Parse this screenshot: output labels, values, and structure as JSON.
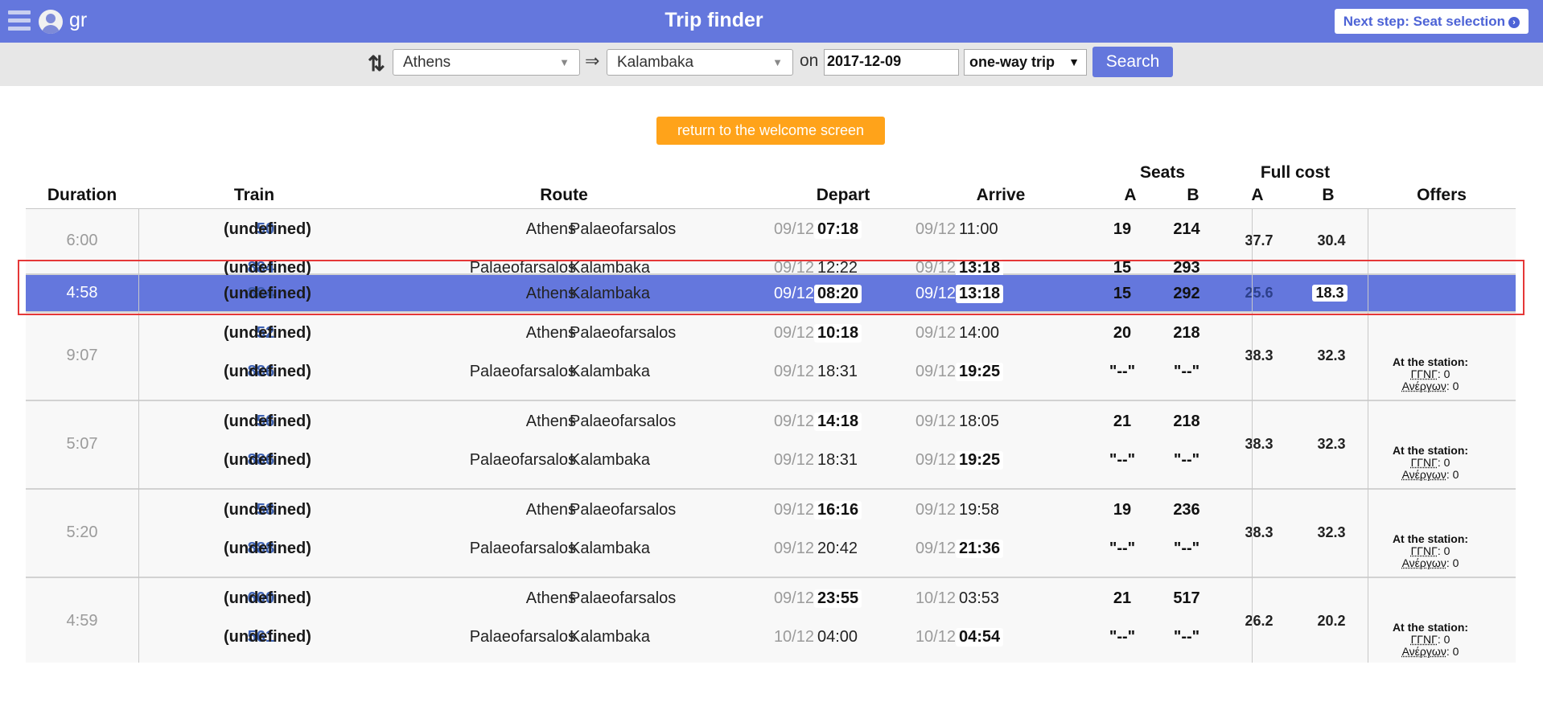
{
  "header": {
    "lang": "gr",
    "title": "Trip finder",
    "next_step": "Next step: Seat selection"
  },
  "search": {
    "from": "Athens",
    "arrow": "⇒",
    "to": "Kalambaka",
    "on_label": "on",
    "date": "2017-12-09",
    "trip_type": "one-way trip",
    "search_label": "Search"
  },
  "welcome_label": "return to the welcome screen",
  "columns": {
    "duration": "Duration",
    "train": "Train",
    "route": "Route",
    "depart": "Depart",
    "arrive": "Arrive",
    "seats": "Seats",
    "full_cost": "Full cost",
    "offers": "Offers",
    "a": "A",
    "b": "B"
  },
  "trips": [
    {
      "duration": "6:00",
      "cost_a": "37.7",
      "cost_b": "30.4",
      "legs": [
        {
          "train": "50",
          "name": "(undefined)",
          "from": "Athens",
          "to": "Palaeofarsalos",
          "dep_date": "09/12",
          "dep_time": "07:18",
          "arr_date": "09/12",
          "arr_time": "11:00",
          "seat_a": "19",
          "seat_b": "214"
        },
        {
          "train": "884",
          "name": "(undefined)",
          "from": "Palaeofarsalos",
          "to": "Kalambaka",
          "dep_date": "09/12",
          "dep_time": "12:22",
          "arr_date": "09/12",
          "arr_time": "13:18",
          "seat_a": "15",
          "seat_b": "293"
        }
      ]
    },
    {
      "duration": "4:58",
      "cost_a": "25.6",
      "cost_b": "18.3",
      "legs": [
        {
          "train": "884",
          "name": "(undefined)",
          "from": "Athens",
          "to": "Kalambaka",
          "dep_date": "09/12",
          "dep_time": "08:20",
          "arr_date": "09/12",
          "arr_time": "13:18",
          "seat_a": "15",
          "seat_b": "292"
        }
      ]
    },
    {
      "duration": "9:07",
      "cost_a": "38.3",
      "cost_b": "32.3",
      "offers": {
        "title": "At the station:",
        "line1_label": "ΓΓΝΓ",
        "line1_value": "0",
        "line2_label": "Ανέργων",
        "line2_value": "0"
      },
      "legs": [
        {
          "train": "52",
          "name": "(undefined)",
          "from": "Athens",
          "to": "Palaeofarsalos",
          "dep_date": "09/12",
          "dep_time": "10:18",
          "arr_date": "09/12",
          "arr_time": "14:00",
          "seat_a": "20",
          "seat_b": "218"
        },
        {
          "train": "886",
          "name": "(undefined)",
          "from": "Palaeofarsalos",
          "to": "Kalambaka",
          "dep_date": "09/12",
          "dep_time": "18:31",
          "arr_date": "09/12",
          "arr_time": "19:25",
          "seat_a": "\"--\"",
          "seat_b": "\"--\""
        }
      ]
    },
    {
      "duration": "5:07",
      "cost_a": "38.3",
      "cost_b": "32.3",
      "offers": {
        "title": "At the station:",
        "line1_label": "ΓΓΝΓ",
        "line1_value": "0",
        "line2_label": "Ανέργων",
        "line2_value": "0"
      },
      "legs": [
        {
          "train": "56",
          "name": "(undefined)",
          "from": "Athens",
          "to": "Palaeofarsalos",
          "dep_date": "09/12",
          "dep_time": "14:18",
          "arr_date": "09/12",
          "arr_time": "18:05",
          "seat_a": "21",
          "seat_b": "218"
        },
        {
          "train": "886",
          "name": "(undefined)",
          "from": "Palaeofarsalos",
          "to": "Kalambaka",
          "dep_date": "09/12",
          "dep_time": "18:31",
          "arr_date": "09/12",
          "arr_time": "19:25",
          "seat_a": "\"--\"",
          "seat_b": "\"--\""
        }
      ]
    },
    {
      "duration": "5:20",
      "cost_a": "38.3",
      "cost_b": "32.3",
      "offers": {
        "title": "At the station:",
        "line1_label": "ΓΓΝΓ",
        "line1_value": "0",
        "line2_label": "Ανέργων",
        "line2_value": "0"
      },
      "legs": [
        {
          "train": "58",
          "name": "(undefined)",
          "from": "Athens",
          "to": "Palaeofarsalos",
          "dep_date": "09/12",
          "dep_time": "16:16",
          "arr_date": "09/12",
          "arr_time": "19:58",
          "seat_a": "19",
          "seat_b": "236"
        },
        {
          "train": "888",
          "name": "(undefined)",
          "from": "Palaeofarsalos",
          "to": "Kalambaka",
          "dep_date": "09/12",
          "dep_time": "20:42",
          "arr_date": "09/12",
          "arr_time": "21:36",
          "seat_a": "\"--\"",
          "seat_b": "\"--\""
        }
      ]
    },
    {
      "duration": "4:59",
      "cost_a": "26.2",
      "cost_b": "20.2",
      "offers": {
        "title": "At the station:",
        "line1_label": "ΓΓΝΓ",
        "line1_value": "0",
        "line2_label": "Ανέργων",
        "line2_value": "0"
      },
      "legs": [
        {
          "train": "600",
          "name": "(undefined)",
          "from": "Athens",
          "to": "Palaeofarsalos",
          "dep_date": "09/12",
          "dep_time": "23:55",
          "arr_date": "10/12",
          "arr_time": "03:53",
          "seat_a": "21",
          "seat_b": "517"
        },
        {
          "train": "561",
          "name": "(undefined)",
          "from": "Palaeofarsalos",
          "to": "Kalambaka",
          "dep_date": "10/12",
          "dep_time": "04:00",
          "arr_date": "10/12",
          "arr_time": "04:54",
          "seat_a": "\"--\"",
          "seat_b": "\"--\""
        }
      ]
    }
  ]
}
